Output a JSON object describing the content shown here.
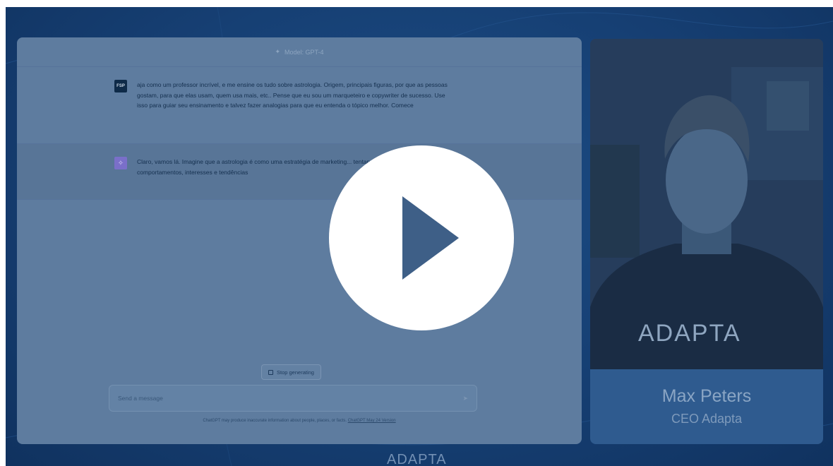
{
  "chat": {
    "model_label": "Model: GPT-4",
    "user_avatar": "FSP",
    "user_message": "aja como um professor incrível, e me ensine os tudo sobre astrologia. Origem, principais figuras, por que as pessoas gostam, para que elas usam, quem usa mais, etc.. Pense que eu sou um marqueteiro e copywriter de sucesso. Use isso para guiar seu ensinamento e talvez fazer analogias para que eu entenda o tópico melhor. Comece",
    "assistant_message": "Claro, vamos lá. Imagine que a astrologia é como uma estratégia de marketing... tentando entender os comportamentos, interesses e tendências",
    "stop_button": "Stop generating",
    "input_placeholder": "Send a message",
    "disclaimer_text": "ChatGPT may produce inaccurate information about people, places, or facts.",
    "disclaimer_link": "ChatGPT May 24 Version"
  },
  "presenter": {
    "name": "Max Peters",
    "role": "CEO Adapta",
    "shirt_logo": "ADAPTA"
  },
  "footer": {
    "logo": "ADAPTA"
  },
  "player": {
    "play_icon": "play-icon"
  },
  "colors": {
    "background": "#163f73",
    "overlay_panel": "#5e7c9f",
    "play_button": "#ffffff",
    "play_triangle": "#3e5f87"
  }
}
